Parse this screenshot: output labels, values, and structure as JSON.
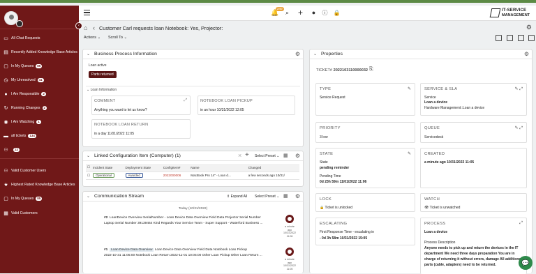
{
  "sidebar": {
    "items": [
      {
        "label": "All Chat Requests",
        "badge": "",
        "icon": "chat-icon"
      },
      {
        "label": "Recently Added Knowledge Base Articles",
        "badge": "",
        "icon": "book-icon"
      },
      {
        "label": "In My Queues",
        "badge": "85",
        "icon": "inbox-icon"
      },
      {
        "label": "My Unresolved",
        "badge": "41",
        "icon": "clock-icon"
      },
      {
        "label": "I Am Responsible",
        "badge": "2",
        "icon": "user-icon"
      },
      {
        "label": "Running Changes",
        "badge": "2",
        "icon": "refresh-icon"
      },
      {
        "label": "I Am Watching",
        "badge": "1",
        "icon": "eye-icon"
      },
      {
        "label": "all tickets",
        "badge": "134",
        "icon": "ticket-icon"
      },
      {
        "label": "",
        "badge": "22",
        "icon": "people-icon"
      },
      {
        "label": "Valid Customer Users",
        "badge": "",
        "icon": "users-icon"
      },
      {
        "label": "Highest Rated Knowledge Base Articles",
        "badge": "",
        "icon": "star-icon"
      },
      {
        "label": "In My Queues",
        "badge": "85",
        "icon": "inbox-icon"
      },
      {
        "label": "Valid Customers",
        "badge": "",
        "icon": "building-icon"
      }
    ]
  },
  "topbar": {
    "bell_badge": "240",
    "logo_line1": "IT-SERVICE",
    "logo_line2": "MANAGEMENT"
  },
  "header": {
    "title": "Customer Carl requests loan Notebook: Yes, Projector:",
    "actions_label": "Actions",
    "scroll_label": "Scroll To"
  },
  "bpi": {
    "title": "Business Process Information",
    "state_label": "Loan active",
    "button": "Parts returned",
    "section": "Loan Information",
    "comment_h": "COMMENT",
    "comment_v": "Anything you want to let us know?",
    "pickup_h": "NOTEBOOK LOAN PICKUP",
    "pickup_v": "in an hour 10/31/2022 12:05",
    "return_h": "NOTEBOOK LOAN RETURN",
    "return_v": "in a day 11/01/2022 11:05"
  },
  "linked": {
    "title": "Linked Configuration Item (Computer) (1)",
    "select_preset": "Select Preset",
    "columns": [
      "Incident State",
      "Deployment State",
      "ConfigItem#",
      "Name",
      "Changed"
    ],
    "row": [
      "Operational",
      "Awarded",
      "2022000006",
      "MacBook Pro 14\" - Loan d...",
      "a few seconds ago 10/31/"
    ]
  },
  "stream": {
    "title": "Communication Stream",
    "expand_all": "Expand All",
    "select_preset": "Select Preset",
    "date": "Today (10/31/2022)",
    "msgs": [
      {
        "num": "#2",
        "l1": "LoanDevice Overview SerialNumber  -  Loan Device Data Overview Field Data Projector Serial Number",
        "l2": "Laptop Serial Number 39139464 Kind Regards Your Service Team  -  Super Support - Waterford Business ...",
        "t1": "a minute",
        "t2": "ago",
        "t3": "10/31/2022",
        "t4": "11:06"
      },
      {
        "num": "#1",
        "tag": "Loan Device Data Overview",
        "l1": "Loan  Device  Data  Overview  Field  Data  Notebook  Loan  Pickup",
        "l2": "2022-10-31  11:05:00  Notebook  Loan  Return  2022-11-01  10:05:00  Other  Loan  Pickup  Other  Loan  Return ...",
        "t1": "a minute",
        "t2": "ago",
        "t3": "10/31/2022",
        "t4": "11:05"
      }
    ]
  },
  "props": {
    "title": "Properties",
    "ticket_label": "TICKET#",
    "ticket_no": "2022103110000032",
    "type_h": "TYPE",
    "type_v": "Service Request",
    "sla_h": "SERVICE & SLA",
    "sla_l1": "Service",
    "sla_l2": "Loan a device",
    "sla_l3": "Hardware Management::Loan a device",
    "prio_h": "PRIORITY",
    "prio_v": "3 low",
    "queue_h": "QUEUE",
    "queue_v": "Servicedesk",
    "state_h": "STATE",
    "state_l": "State",
    "state_v": "pending reminder",
    "pt_l": "Pending Time",
    "pt_v": "0d 23h 59m   11/01/2022 11:06",
    "created_h": "CREATED",
    "created_v": "a minute ago    10/31/2022 11:05",
    "lock_h": "LOCK",
    "lock_v": "Ticket is unlocked",
    "watch_h": "WATCH",
    "watch_v": "Ticket is unwatched",
    "esc_h": "ESCALATING",
    "esc_l": "First Response Time - escalating in",
    "esc_v": "- 0d 3h 58m   10/31/2022 15:05",
    "proc_h": "PROCESS",
    "proc_v": "Loan a device",
    "proc_l": "Process Description",
    "proc_d1": "Anyone needs to pick up and return the devices in the IT",
    "proc_d2": "department We need three days preparation You are in",
    "proc_d3": "charge of returning it without errors, damage All additional",
    "proc_d4": "parts (cable, adapters) need to be returned."
  },
  "colors": {
    "sidebar": "#701818",
    "accent": "#5c8a45",
    "chat": "#2e8a4b"
  }
}
